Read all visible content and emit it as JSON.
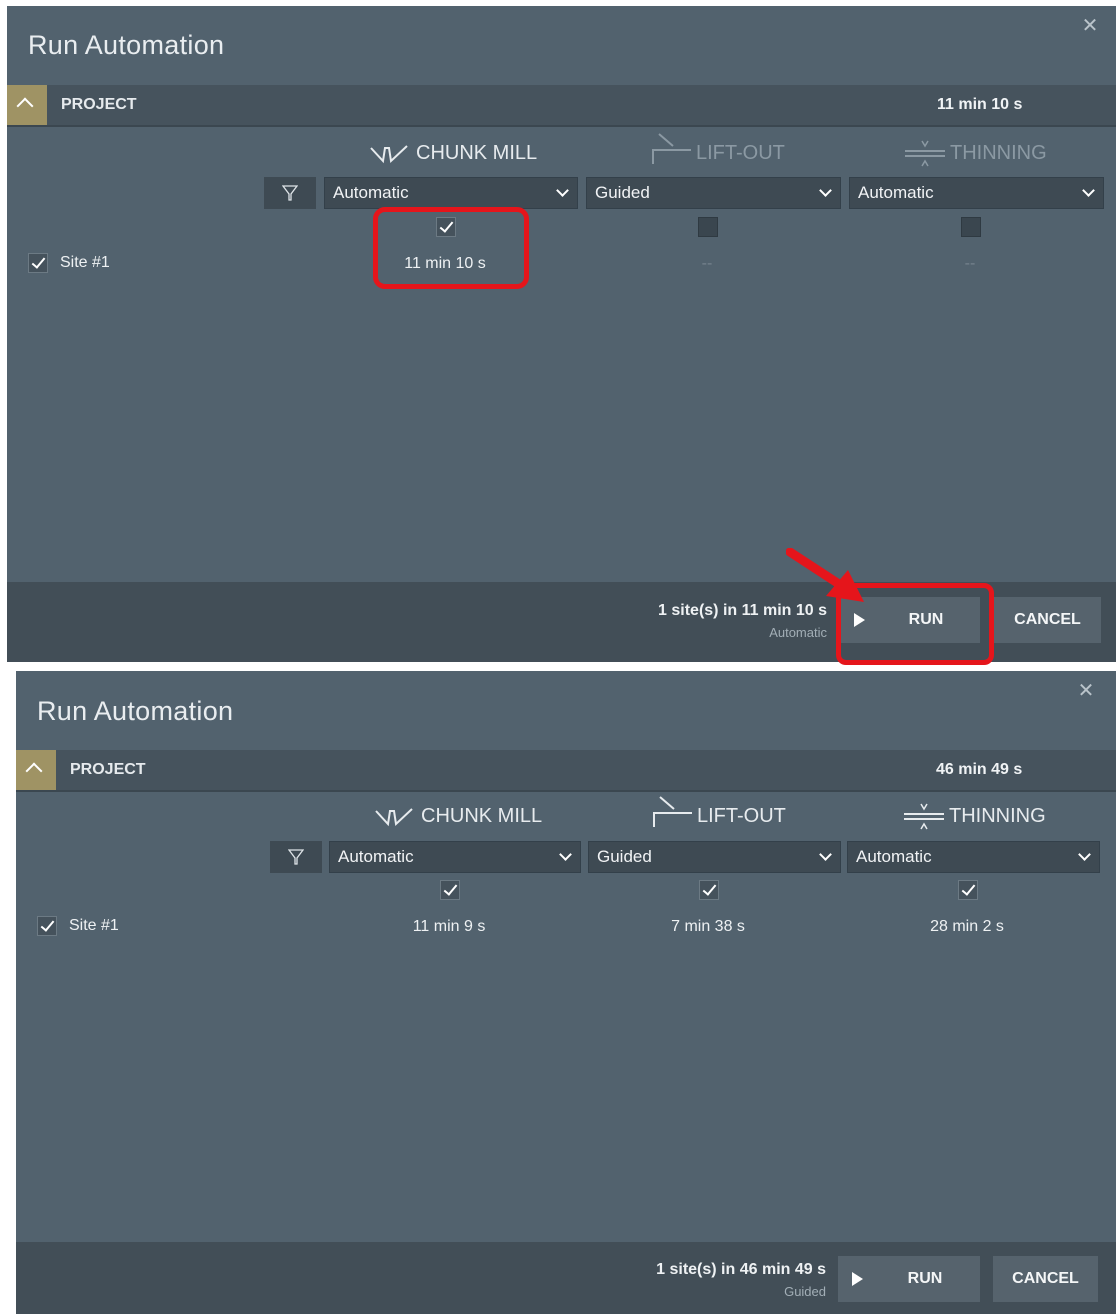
{
  "top": {
    "title": "Run Automation",
    "project": {
      "label": "PROJECT",
      "time": "11 min 10 s"
    },
    "columns": [
      {
        "label": "CHUNK MILL",
        "mode": "Automatic",
        "checked": true
      },
      {
        "label": "LIFT-OUT",
        "mode": "Guided",
        "checked": false
      },
      {
        "label": "THINNING",
        "mode": "Automatic",
        "checked": false
      }
    ],
    "site": {
      "label": "Site #1",
      "checked": true,
      "times": [
        "11 min 10 s",
        "--",
        "--"
      ]
    },
    "footer": {
      "summary": "1 site(s) in 11 min 10 s",
      "mode": "Automatic",
      "run": "RUN",
      "cancel": "CANCEL"
    }
  },
  "bottom": {
    "title": "Run Automation",
    "project": {
      "label": "PROJECT",
      "time": "46 min 49 s"
    },
    "columns": [
      {
        "label": "CHUNK MILL",
        "mode": "Automatic",
        "checked": true
      },
      {
        "label": "LIFT-OUT",
        "mode": "Guided",
        "checked": true
      },
      {
        "label": "THINNING",
        "mode": "Automatic",
        "checked": true
      }
    ],
    "site": {
      "label": "Site #1",
      "checked": true,
      "times": [
        "11 min 9 s",
        "7 min 38 s",
        "28 min 2 s"
      ]
    },
    "footer": {
      "summary": "1 site(s) in 46 min 49 s",
      "mode": "Guided",
      "run": "RUN",
      "cancel": "CANCEL"
    }
  },
  "colors": {
    "dialog_bg": "#52626e",
    "header_bar": "#46535d",
    "collapse_accent": "#9f9364",
    "highlight": "#e5151b"
  },
  "icons": [
    "close-icon",
    "chevron-up-icon",
    "chunk-mill-icon",
    "lift-out-icon",
    "thinning-icon",
    "filter-icon",
    "chevron-down-icon",
    "checkbox-icon",
    "play-icon"
  ]
}
